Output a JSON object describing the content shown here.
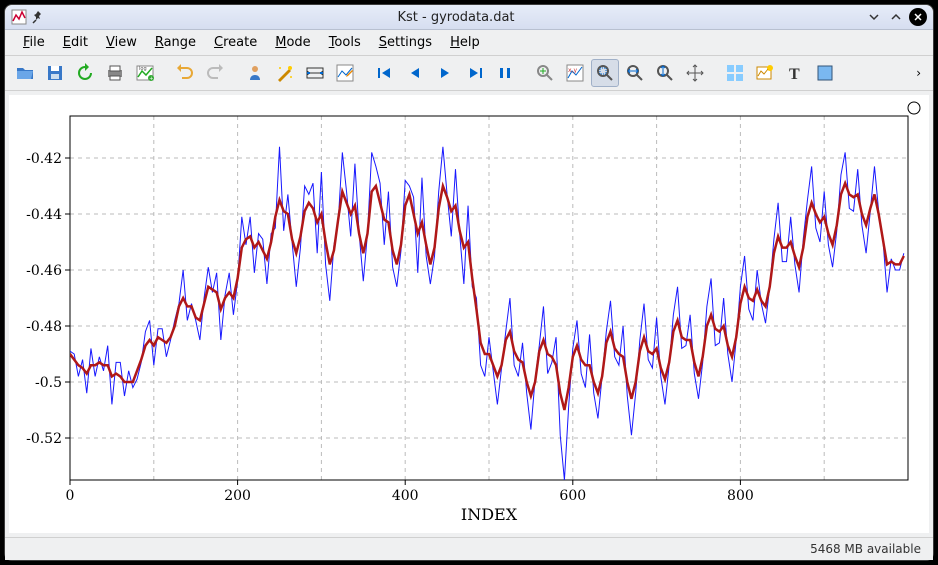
{
  "window": {
    "title": "Kst - gyrodata.dat",
    "minimize_icon": "chevron-down",
    "maximize_icon": "chevron-up",
    "close_icon": "close"
  },
  "menubar": {
    "items": [
      {
        "label": "File",
        "u": 0
      },
      {
        "label": "Edit",
        "u": 0
      },
      {
        "label": "View",
        "u": 0
      },
      {
        "label": "Range",
        "u": 0
      },
      {
        "label": "Create",
        "u": 0
      },
      {
        "label": "Mode",
        "u": 0
      },
      {
        "label": "Tools",
        "u": 0
      },
      {
        "label": "Settings",
        "u": 0
      },
      {
        "label": "Help",
        "u": 0
      }
    ]
  },
  "toolbar": {
    "groups": [
      [
        "open-icon",
        "save-icon",
        "reload-icon",
        "print-icon",
        "log-icon"
      ],
      [
        "undo-icon",
        "redo-icon"
      ],
      [
        "data-manager-icon",
        "data-wizard-icon",
        "range-icon",
        "edit-object-icon"
      ],
      [
        "back-end-icon",
        "back-icon",
        "forward-icon",
        "forward-end-icon",
        "pause-icon"
      ],
      [
        "zoom-in-icon",
        "zoom-xy-icon",
        "zoom-rect-icon",
        "zoom-x-icon",
        "zoom-y-icon",
        "move-icon"
      ],
      [
        "layout-grid-icon",
        "new-tab-icon",
        "text-icon",
        "box-icon"
      ]
    ],
    "active": "zoom-rect-icon",
    "overflow": "›"
  },
  "statusbar": {
    "memory": "5468 MB available"
  },
  "chart_data": {
    "type": "line",
    "xlabel": "INDEX",
    "ylabel": "",
    "x_ticks": [
      0,
      200,
      400,
      600,
      800
    ],
    "y_ticks": [
      -0.52,
      -0.5,
      -0.48,
      -0.46,
      -0.44,
      -0.42
    ],
    "xlim": [
      0,
      1000
    ],
    "ylim": [
      -0.535,
      -0.405
    ],
    "series": [
      {
        "name": "raw",
        "color": "#1818ff",
        "x_step": 5,
        "values": [
          -0.489,
          -0.49,
          -0.498,
          -0.492,
          -0.504,
          -0.488,
          -0.498,
          -0.491,
          -0.496,
          -0.487,
          -0.508,
          -0.493,
          -0.493,
          -0.505,
          -0.496,
          -0.502,
          -0.499,
          -0.493,
          -0.482,
          -0.478,
          -0.494,
          -0.481,
          -0.481,
          -0.491,
          -0.485,
          -0.478,
          -0.472,
          -0.46,
          -0.478,
          -0.472,
          -0.478,
          -0.485,
          -0.47,
          -0.459,
          -0.468,
          -0.461,
          -0.485,
          -0.469,
          -0.461,
          -0.476,
          -0.464,
          -0.441,
          -0.451,
          -0.441,
          -0.461,
          -0.447,
          -0.449,
          -0.465,
          -0.447,
          -0.445,
          -0.416,
          -0.446,
          -0.433,
          -0.45,
          -0.466,
          -0.452,
          -0.43,
          -0.433,
          -0.429,
          -0.454,
          -0.425,
          -0.458,
          -0.471,
          -0.451,
          -0.443,
          -0.418,
          -0.432,
          -0.448,
          -0.422,
          -0.447,
          -0.464,
          -0.447,
          -0.418,
          -0.423,
          -0.429,
          -0.451,
          -0.432,
          -0.459,
          -0.466,
          -0.453,
          -0.428,
          -0.43,
          -0.434,
          -0.461,
          -0.427,
          -0.455,
          -0.465,
          -0.455,
          -0.432,
          -0.416,
          -0.433,
          -0.448,
          -0.424,
          -0.447,
          -0.465,
          -0.437,
          -0.466,
          -0.47,
          -0.494,
          -0.498,
          -0.484,
          -0.496,
          -0.508,
          -0.495,
          -0.482,
          -0.47,
          -0.494,
          -0.498,
          -0.486,
          -0.504,
          -0.517,
          -0.499,
          -0.487,
          -0.473,
          -0.497,
          -0.493,
          -0.484,
          -0.519,
          -0.535,
          -0.509,
          -0.488,
          -0.478,
          -0.497,
          -0.502,
          -0.483,
          -0.504,
          -0.513,
          -0.498,
          -0.482,
          -0.471,
          -0.491,
          -0.494,
          -0.48,
          -0.505,
          -0.519,
          -0.504,
          -0.485,
          -0.472,
          -0.492,
          -0.495,
          -0.477,
          -0.498,
          -0.508,
          -0.494,
          -0.476,
          -0.466,
          -0.488,
          -0.487,
          -0.476,
          -0.497,
          -0.506,
          -0.493,
          -0.473,
          -0.463,
          -0.487,
          -0.486,
          -0.47,
          -0.49,
          -0.5,
          -0.485,
          -0.466,
          -0.455,
          -0.474,
          -0.478,
          -0.46,
          -0.472,
          -0.479,
          -0.466,
          -0.449,
          -0.436,
          -0.457,
          -0.457,
          -0.441,
          -0.458,
          -0.468,
          -0.449,
          -0.435,
          -0.423,
          -0.445,
          -0.45,
          -0.432,
          -0.451,
          -0.459,
          -0.446,
          -0.426,
          -0.418,
          -0.438,
          -0.439,
          -0.424,
          -0.444,
          -0.454,
          -0.439,
          -0.423,
          -0.439,
          -0.449,
          -0.468,
          -0.456,
          -0.46,
          -0.46,
          -0.454
        ]
      },
      {
        "name": "smoothed",
        "color": "#b01818",
        "x_step": 5,
        "values": [
          -0.49,
          -0.492,
          -0.494,
          -0.495,
          -0.497,
          -0.494,
          -0.494,
          -0.493,
          -0.494,
          -0.494,
          -0.498,
          -0.497,
          -0.498,
          -0.5,
          -0.5,
          -0.5,
          -0.496,
          -0.492,
          -0.487,
          -0.485,
          -0.487,
          -0.484,
          -0.485,
          -0.486,
          -0.484,
          -0.48,
          -0.473,
          -0.47,
          -0.473,
          -0.473,
          -0.477,
          -0.478,
          -0.472,
          -0.466,
          -0.467,
          -0.468,
          -0.474,
          -0.47,
          -0.468,
          -0.47,
          -0.463,
          -0.452,
          -0.449,
          -0.448,
          -0.452,
          -0.45,
          -0.453,
          -0.456,
          -0.45,
          -0.441,
          -0.435,
          -0.439,
          -0.44,
          -0.449,
          -0.454,
          -0.448,
          -0.439,
          -0.436,
          -0.438,
          -0.443,
          -0.44,
          -0.45,
          -0.458,
          -0.453,
          -0.442,
          -0.432,
          -0.436,
          -0.44,
          -0.437,
          -0.447,
          -0.454,
          -0.447,
          -0.432,
          -0.43,
          -0.436,
          -0.442,
          -0.443,
          -0.453,
          -0.458,
          -0.451,
          -0.437,
          -0.433,
          -0.44,
          -0.447,
          -0.443,
          -0.451,
          -0.458,
          -0.452,
          -0.438,
          -0.43,
          -0.434,
          -0.439,
          -0.437,
          -0.446,
          -0.452,
          -0.45,
          -0.463,
          -0.474,
          -0.486,
          -0.49,
          -0.49,
          -0.494,
          -0.498,
          -0.494,
          -0.485,
          -0.482,
          -0.489,
          -0.492,
          -0.493,
          -0.5,
          -0.505,
          -0.5,
          -0.489,
          -0.485,
          -0.49,
          -0.491,
          -0.494,
          -0.504,
          -0.51,
          -0.502,
          -0.491,
          -0.487,
          -0.492,
          -0.494,
          -0.494,
          -0.5,
          -0.504,
          -0.498,
          -0.486,
          -0.482,
          -0.488,
          -0.49,
          -0.491,
          -0.5,
          -0.506,
          -0.5,
          -0.489,
          -0.484,
          -0.489,
          -0.49,
          -0.488,
          -0.495,
          -0.499,
          -0.493,
          -0.482,
          -0.478,
          -0.484,
          -0.485,
          -0.485,
          -0.493,
          -0.498,
          -0.491,
          -0.48,
          -0.476,
          -0.481,
          -0.482,
          -0.48,
          -0.487,
          -0.491,
          -0.484,
          -0.472,
          -0.466,
          -0.47,
          -0.471,
          -0.467,
          -0.471,
          -0.473,
          -0.466,
          -0.454,
          -0.448,
          -0.452,
          -0.452,
          -0.45,
          -0.455,
          -0.459,
          -0.452,
          -0.441,
          -0.436,
          -0.44,
          -0.443,
          -0.441,
          -0.447,
          -0.451,
          -0.444,
          -0.433,
          -0.429,
          -0.433,
          -0.434,
          -0.433,
          -0.44,
          -0.444,
          -0.438,
          -0.433,
          -0.44,
          -0.449,
          -0.458,
          -0.457,
          -0.458,
          -0.458,
          -0.455
        ]
      }
    ]
  }
}
